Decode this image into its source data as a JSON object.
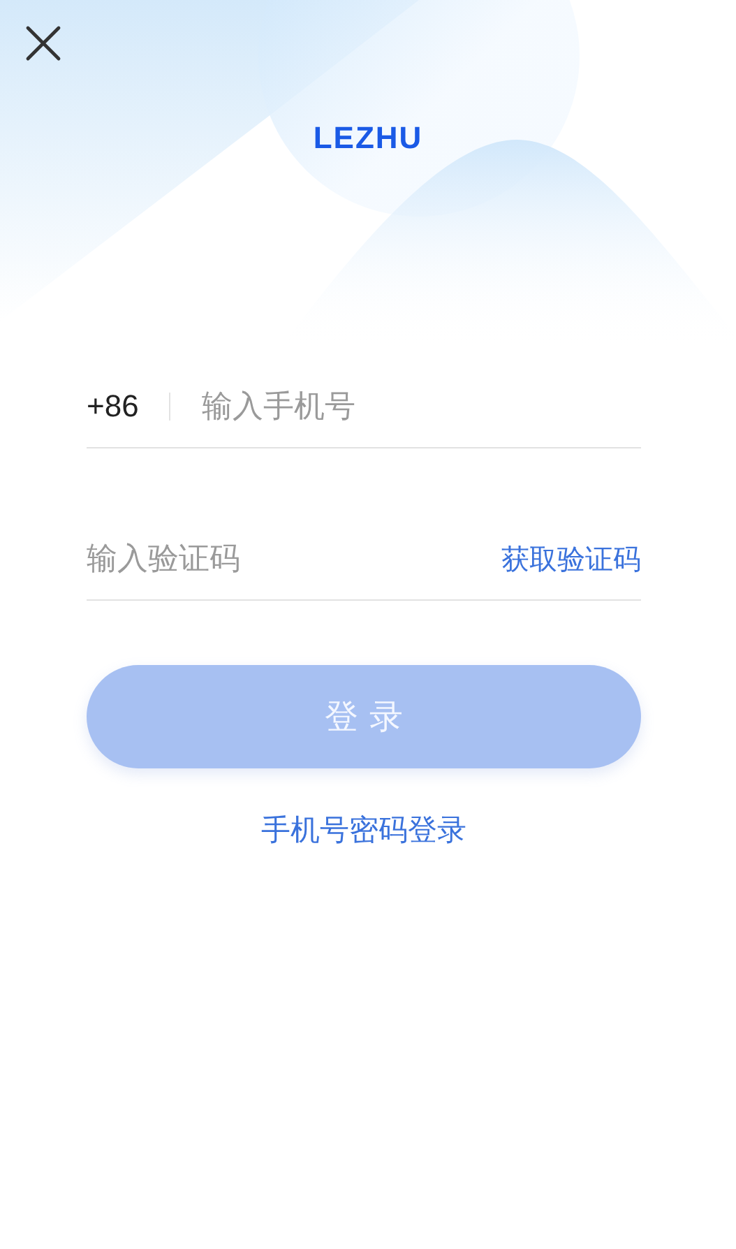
{
  "header": {
    "logo": "LEZHU"
  },
  "phone_field": {
    "country_code": "+86",
    "placeholder": "输入手机号"
  },
  "code_field": {
    "placeholder": "输入验证码",
    "action": "获取验证码"
  },
  "login_button": {
    "label": "登 录",
    "disabled": true
  },
  "alt_login_link": "手机号密码登录"
}
